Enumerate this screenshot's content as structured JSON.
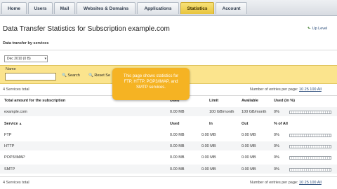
{
  "tabs": [
    {
      "label": "Home",
      "active": false
    },
    {
      "label": "Users",
      "active": false
    },
    {
      "label": "Mail",
      "active": false
    },
    {
      "label": "Websites & Domains",
      "active": false
    },
    {
      "label": "Applications",
      "active": false
    },
    {
      "label": "Statistics",
      "active": true
    },
    {
      "label": "Account",
      "active": false
    }
  ],
  "page": {
    "title": "Data Transfer Statistics for Subscription example.com",
    "up_level": "Up Level",
    "section_label": "Data transfer by services"
  },
  "period": {
    "value": "Dec 2010 (0 B)"
  },
  "search": {
    "name_label": "Name",
    "input_value": "",
    "search_label": "Search",
    "reset_label": "Reset Se"
  },
  "tooltip": {
    "text": "This page shows statistics for FTP, HTTP, POP3/IMAP, and SMTP services."
  },
  "summary": {
    "total_count": "4 Services total",
    "entries_label": "Number of entries per page:",
    "entries_options": "10 25 100 All"
  },
  "totals_table": {
    "headers": {
      "name": "Total amount for the subscription",
      "used": "Used",
      "limit": "Limit",
      "available": "Available",
      "used_pct": "Used (in %)"
    },
    "row": {
      "name": "example.com",
      "used": "0.00 MB",
      "limit": "100 GB/month",
      "available": "100 GB/month",
      "pct": "0%",
      "fill": 0
    }
  },
  "services_table": {
    "headers": {
      "service": "Service",
      "sort_indicator": "▲",
      "used": "Used",
      "in": "In",
      "out": "Out",
      "pct_of_all": "% of All"
    },
    "rows": [
      {
        "service": "FTP",
        "used": "0.00 MB",
        "in": "0.00 MB",
        "out": "0.00 MB",
        "pct": "0%",
        "fill": 0
      },
      {
        "service": "HTTP",
        "used": "0.00 MB",
        "in": "0.00 MB",
        "out": "0.00 MB",
        "pct": "0%",
        "fill": 0
      },
      {
        "service": "POP3/IMAP",
        "used": "0.00 MB",
        "in": "0.00 MB",
        "out": "0.00 MB",
        "pct": "0%",
        "fill": 0
      },
      {
        "service": "SMTP",
        "used": "0.00 MB",
        "in": "0.00 MB",
        "out": "0.00 MB",
        "pct": "0%",
        "fill": 0
      }
    ]
  },
  "footer": {
    "total_count": "4 Services total",
    "entries_label": "Number of entries per page:",
    "entries_options": "10 25 100 All"
  },
  "colors": {
    "active_tab": "#e8c43c",
    "search_panel": "#fbe48d",
    "tooltip": "#f5b323",
    "link": "#2a4c7a"
  }
}
